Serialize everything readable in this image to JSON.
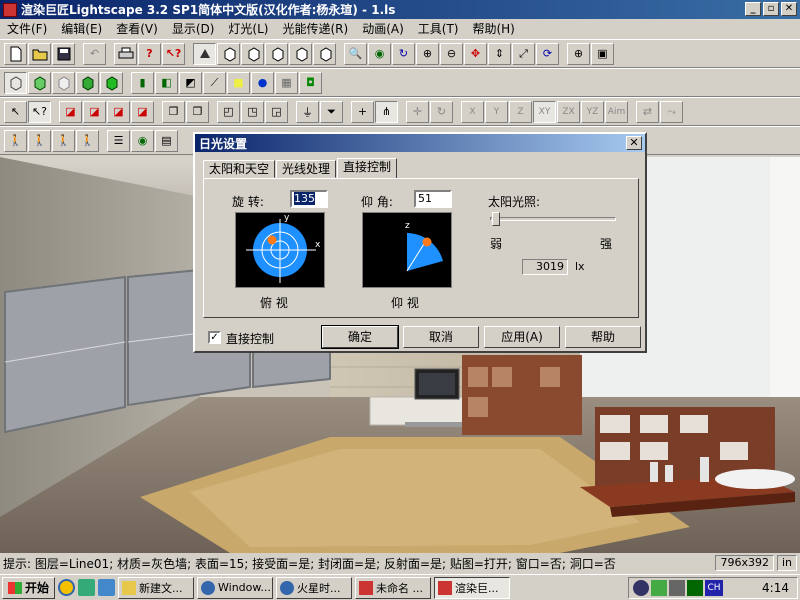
{
  "window": {
    "title": "渲染巨匠Lightscape 3.2 SP1简体中文版(汉化作者:杨永瑄) - 1.ls",
    "min": "_",
    "restore": "▫",
    "close": "✕"
  },
  "menu": [
    "文件(F)",
    "编辑(E)",
    "查看(V)",
    "显示(D)",
    "灯光(L)",
    "光能传递(R)",
    "动画(A)",
    "工具(T)",
    "帮助(H)"
  ],
  "toolbar": {
    "axis_x": "X",
    "axis_y": "Y",
    "axis_z": "Z",
    "axis_xy": "XY",
    "axis_zx": "ZX",
    "axis_yz": "YZ",
    "axis_aim": "Aim"
  },
  "dialog": {
    "title": "日光设置",
    "close": "✕",
    "tabs": [
      "太阳和天空",
      "光线处理",
      "直接控制"
    ],
    "rotation_label": "旋 转:",
    "rotation_value": "135",
    "elevation_label": "仰 角:",
    "elevation_value": "51",
    "top_view_caption": "俯 视",
    "elev_view_caption": "仰 视",
    "sun_label": "太阳光照:",
    "weak": "弱",
    "strong": "强",
    "intensity_value": "3019",
    "intensity_unit": "lx",
    "sun_level": 0.02,
    "direct_control_label": "直接控制",
    "direct_control_check": "✓",
    "compass_y": "y",
    "compass_x": "x",
    "compass_z": "z",
    "btn_ok": "确定",
    "btn_cancel": "取消",
    "btn_apply": "应用(A)",
    "btn_help": "帮助"
  },
  "status": {
    "message": "提示: 图层=Line01; 材质=灰色墙; 表面=15; 接受面=是; 封闭面=是; 反射面=是; 贴图=打开; 窗口=否; 洞口=否",
    "size": "796x392",
    "unit": "in"
  },
  "taskbar": {
    "start": "开始",
    "tasks": [
      "新建文...",
      "Window...",
      "火星时...",
      "未命名 ...",
      "渲染巨..."
    ],
    "clock": "4:14",
    "lang": "CH"
  }
}
